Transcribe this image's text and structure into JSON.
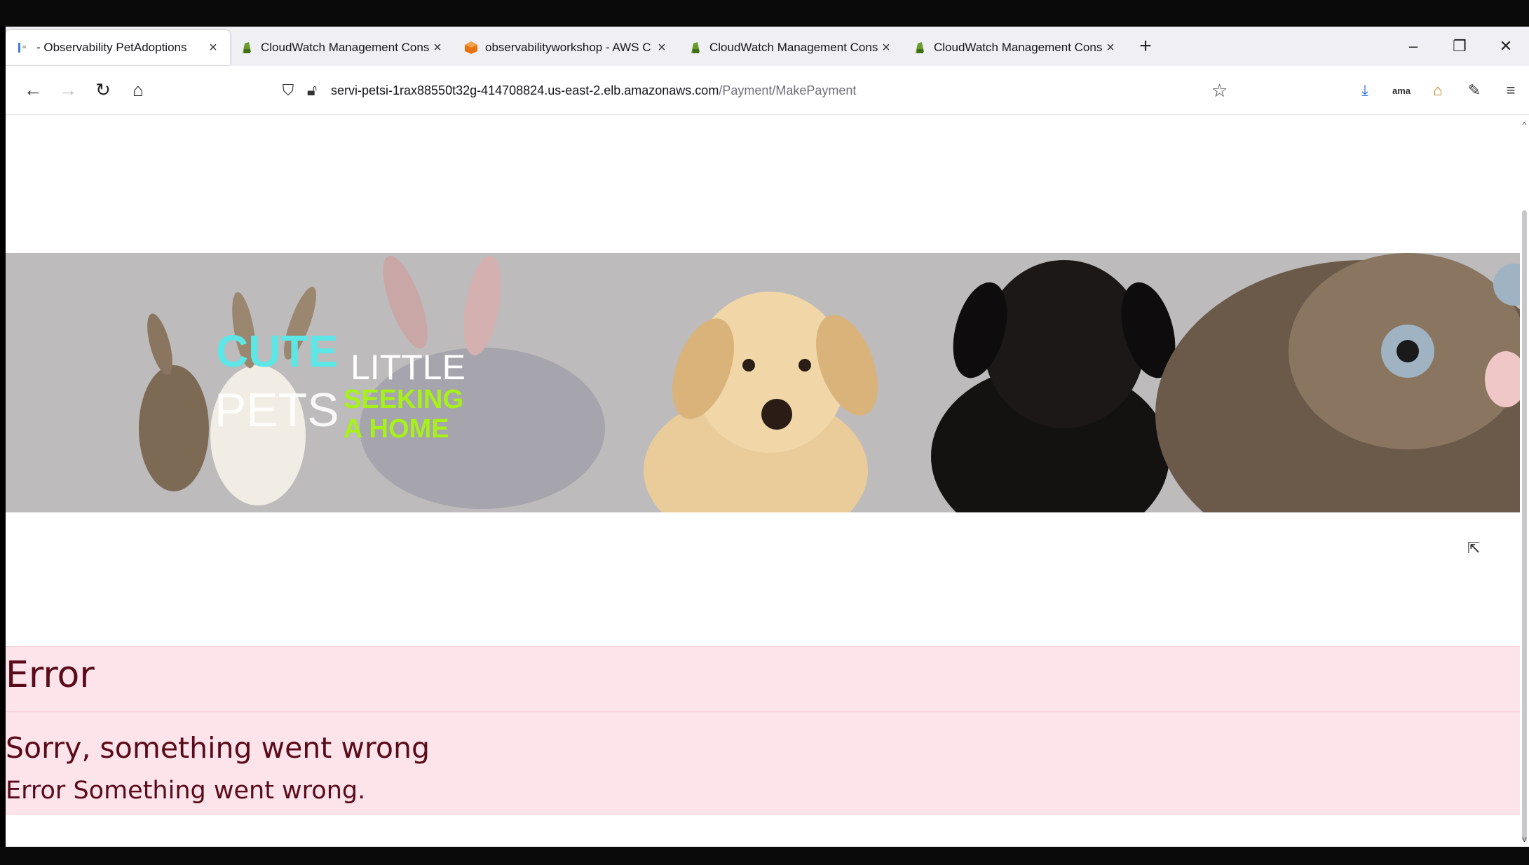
{
  "browser": {
    "tabs": [
      {
        "label": "- Observability PetAdoptions",
        "favicon": "page-icon",
        "active": true
      },
      {
        "label": "CloudWatch Management Cons",
        "favicon": "cloudwatch-icon"
      },
      {
        "label": "observabilityworkshop - AWS C",
        "favicon": "aws-cube-icon"
      },
      {
        "label": "CloudWatch Management Cons",
        "favicon": "cloudwatch-icon"
      },
      {
        "label": "CloudWatch Management Cons",
        "favicon": "cloudwatch-icon"
      }
    ],
    "url_host": "servi-petsi-1rax88550t32g-414708824.us-east-2.elb.amazonaws.com",
    "url_path": "/Payment/MakePayment"
  },
  "banner": {
    "line1": "CUTE",
    "line1b": "LITTLE",
    "line2": "PETS",
    "line2b": "SEEKING",
    "line3": "A HOME",
    "colors": {
      "cute": "#5de6e6",
      "seeking": "#a6f11a",
      "background": "#bdbbbb"
    }
  },
  "error": {
    "title": "Error",
    "subtitle": "Sorry, something went wrong",
    "message": "Error Something went wrong."
  },
  "colors": {
    "alert_bg": "#fce4ea",
    "alert_text": "#5a0a1a"
  }
}
